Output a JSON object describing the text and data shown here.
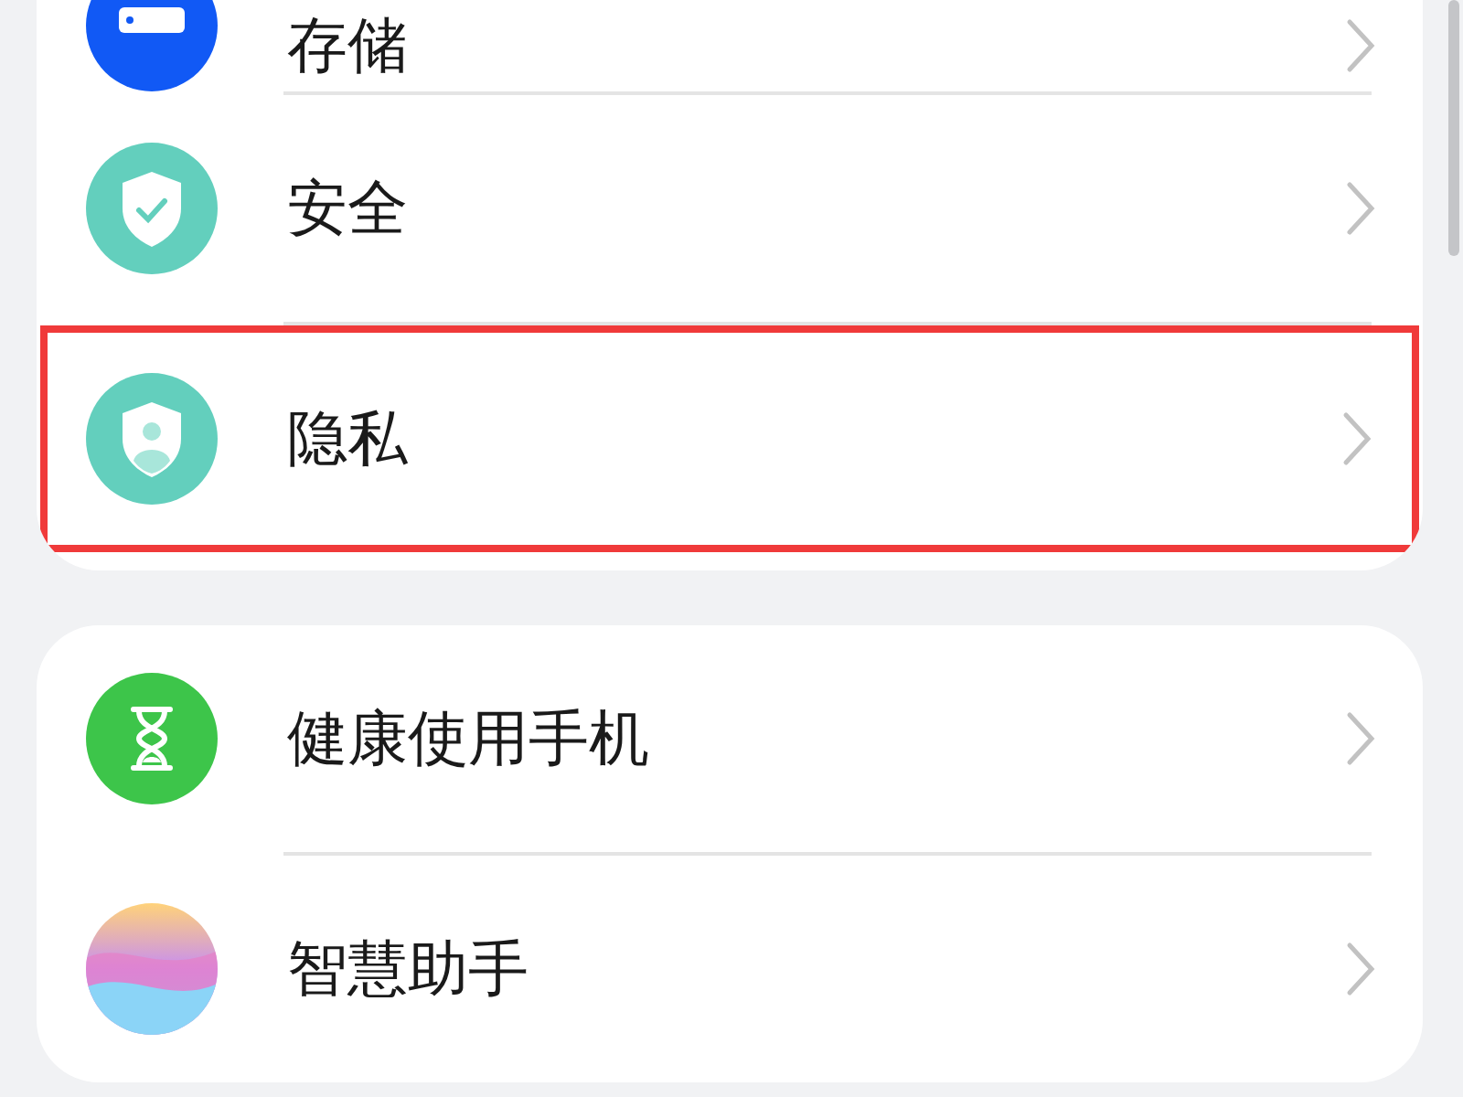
{
  "groups": [
    {
      "items": [
        {
          "label": "存储",
          "kind": "storage",
          "clipped": true,
          "highlighted": false
        },
        {
          "label": "安全",
          "kind": "security",
          "clipped": false,
          "highlighted": false
        },
        {
          "label": "隐私",
          "kind": "privacy",
          "clipped": false,
          "highlighted": true
        }
      ]
    },
    {
      "items": [
        {
          "label": "健康使用手机",
          "kind": "hourglass",
          "clipped": false,
          "highlighted": false
        },
        {
          "label": "智慧助手",
          "kind": "assistant",
          "clipped": false,
          "highlighted": false
        }
      ]
    }
  ]
}
